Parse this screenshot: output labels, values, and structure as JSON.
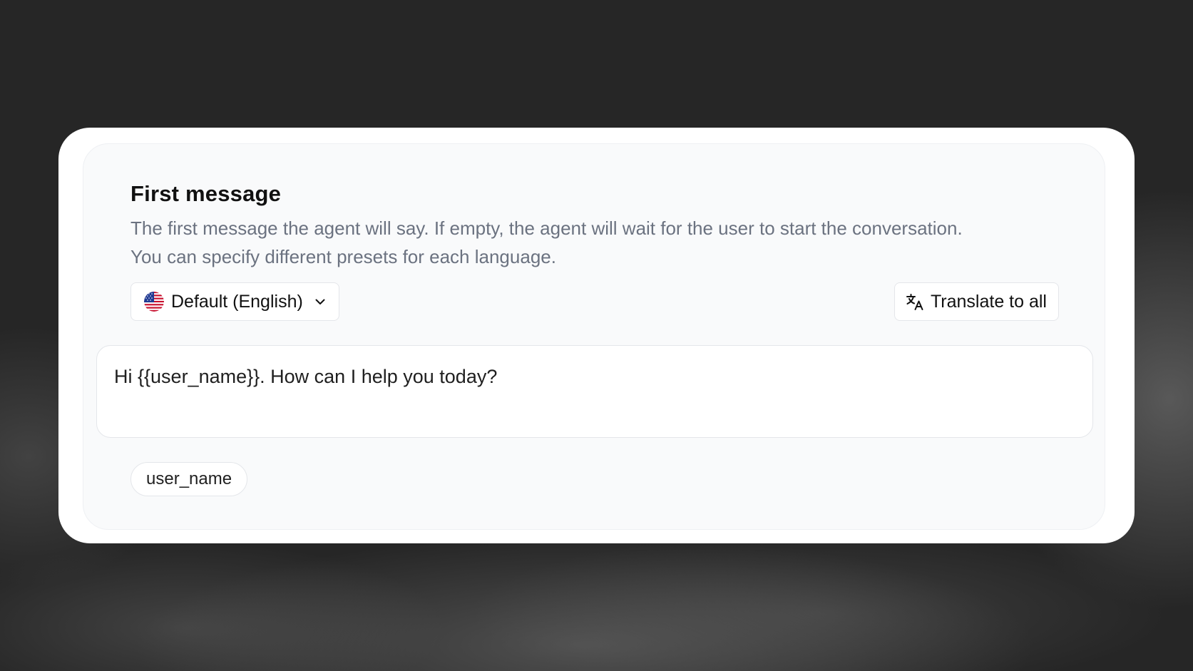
{
  "section": {
    "title": "First message",
    "description": "The first message the agent will say. If empty, the agent will wait for the user to start the conversation. You can specify different presets for each language."
  },
  "language_select": {
    "selected": "Default (English)",
    "flag_icon": "us-flag-icon",
    "chevron_icon": "chevron-down-icon"
  },
  "translate_button": {
    "label": "Translate to all",
    "icon": "translate-icon"
  },
  "message_input": {
    "value": "Hi {{user_name}}. How can I help you today?"
  },
  "variables": [
    {
      "label": "user_name"
    }
  ],
  "colors": {
    "background": "#262626",
    "card": "#ffffff",
    "panel": "#f9fafb",
    "muted_text": "#6b7280",
    "border": "#e4e6ea"
  }
}
